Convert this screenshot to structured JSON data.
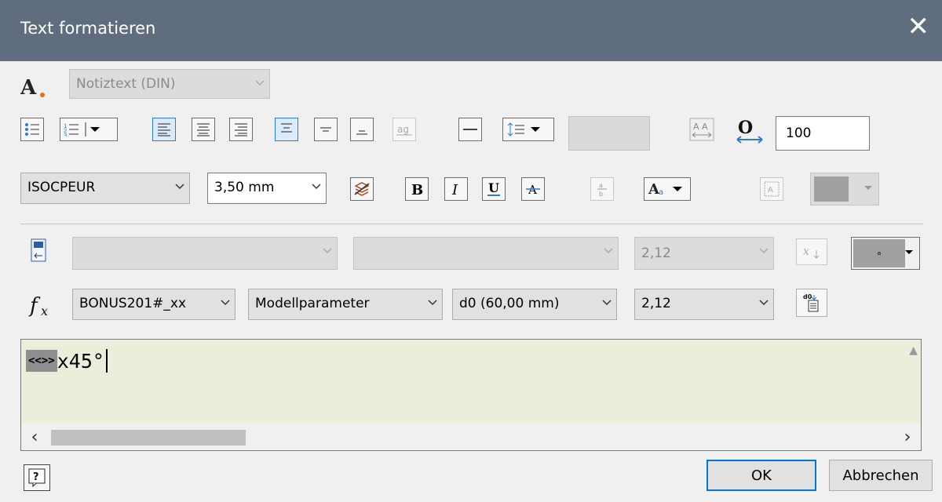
{
  "window": {
    "title": "Text formatieren",
    "close_glyph": "✕"
  },
  "style_row": {
    "style_value": "Notiztext (DIN)"
  },
  "row1": {
    "spacing_value": "100"
  },
  "font_row": {
    "font_value": "ISOCPEUR",
    "size_value": "3,50 mm"
  },
  "param_row_disabled": {
    "third_value": "2,12"
  },
  "param_row": {
    "fx_label": "fx",
    "part_value": "BONUS201#_xx",
    "type_value": "Modellparameter",
    "param_value": "d0 (60,00 mm)",
    "precision_value": "2,12"
  },
  "editor": {
    "selected_token": "<<>>",
    "text": "x45°"
  },
  "footer": {
    "ok_label": "OK",
    "cancel_label": "Abbrechen"
  },
  "colors": {
    "titlebar": "#5f6d7f",
    "editor_bg": "#ededdc",
    "active_border": "#2d7ad6"
  }
}
